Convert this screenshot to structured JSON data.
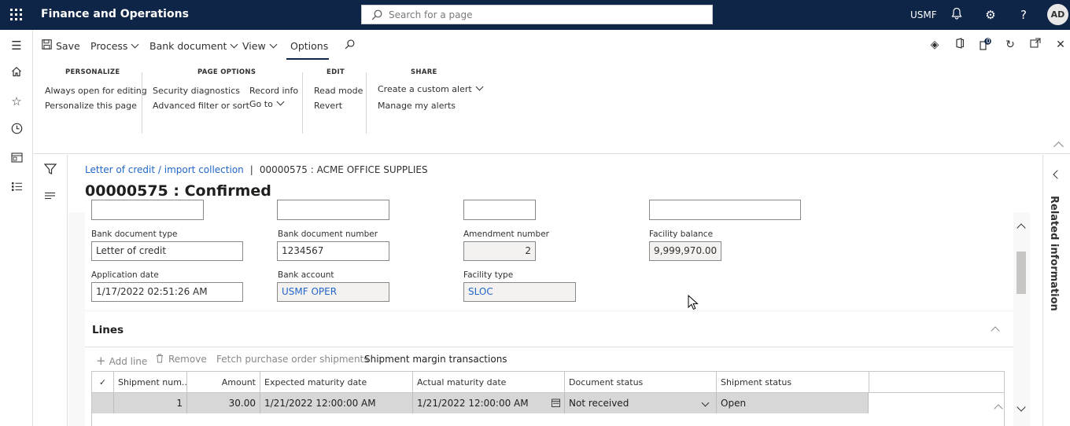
{
  "topbar": {
    "app_title": "Finance and Operations",
    "search_placeholder": "Search for a page",
    "company": "USMF",
    "avatar_initials": "AD"
  },
  "actionbar": {
    "save": "Save",
    "process": "Process",
    "bank_document": "Bank document",
    "view": "View",
    "options": "Options"
  },
  "ribbon": {
    "personalize": {
      "title": "PERSONALIZE",
      "items": [
        "Always open for editing",
        "Personalize this page"
      ]
    },
    "page_options": {
      "title": "PAGE OPTIONS",
      "items": [
        "Security diagnostics",
        "Advanced filter or sort",
        "Record info",
        "Go to"
      ]
    },
    "edit": {
      "title": "EDIT",
      "items": [
        "Read mode",
        "Revert"
      ]
    },
    "share": {
      "title": "SHARE",
      "items": [
        "Create a custom alert",
        "Manage my alerts"
      ]
    },
    "notification_count": "0"
  },
  "breadcrumb": {
    "link": "Letter of credit / import collection",
    "current": "00000575 : ACME OFFICE SUPPLIES"
  },
  "page_title": "00000575 : Confirmed",
  "form": {
    "bank_document_type": {
      "label": "Bank document type",
      "value": "Letter of credit"
    },
    "bank_document_number": {
      "label": "Bank document number",
      "value": "1234567"
    },
    "amendment_number": {
      "label": "Amendment number",
      "value": "2"
    },
    "facility_balance": {
      "label": "Facility balance",
      "value": "9,999,970.00"
    },
    "application_date": {
      "label": "Application date",
      "value": "1/17/2022 02:51:26 AM"
    },
    "bank_account": {
      "label": "Bank account",
      "value": "USMF OPER"
    },
    "facility_type": {
      "label": "Facility type",
      "value": "SLOC"
    }
  },
  "lines": {
    "title": "Lines",
    "toolbar": {
      "add_line": "Add line",
      "remove": "Remove",
      "fetch": "Fetch purchase order shipments",
      "shipment_margin": "Shipment margin transactions"
    },
    "columns": [
      "Shipment num...",
      "Amount",
      "Expected maturity date",
      "Actual maturity date",
      "Document status",
      "Shipment status"
    ],
    "rows": [
      {
        "shipment_num": "1",
        "amount": "30.00",
        "expected": "1/21/2022 12:00:00 AM",
        "actual": "1/21/2022 12:00:00 AM",
        "doc_status": "Not received",
        "ship_status": "Open"
      }
    ]
  },
  "related_information": "Related information"
}
